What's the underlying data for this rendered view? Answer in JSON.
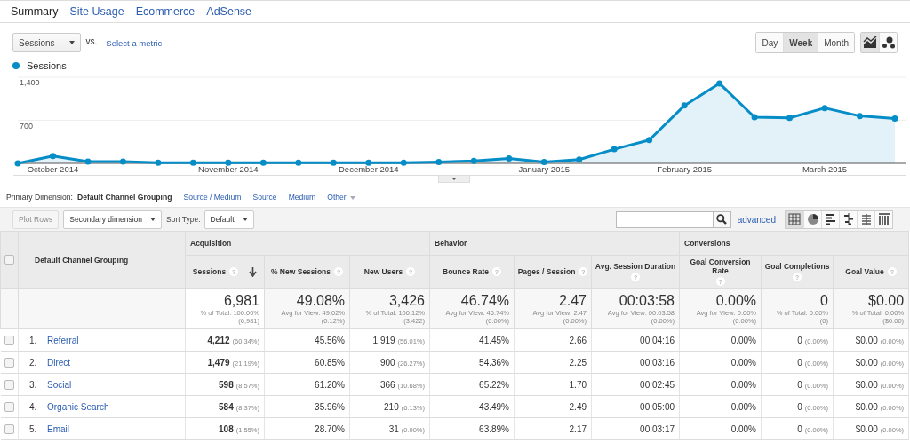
{
  "tabs": [
    {
      "label": "Summary",
      "selected": true
    },
    {
      "label": "Site Usage",
      "selected": false
    },
    {
      "label": "Ecommerce",
      "selected": false
    },
    {
      "label": "AdSense",
      "selected": false
    }
  ],
  "metric_selector": {
    "value": "Sessions",
    "vs_label": "vs.",
    "compare_link": "Select a metric"
  },
  "granularity": [
    {
      "label": "Day",
      "selected": false
    },
    {
      "label": "Week",
      "selected": true
    },
    {
      "label": "Month",
      "selected": false
    }
  ],
  "chart_type_buttons": [
    {
      "kind": "line",
      "selected": true
    },
    {
      "kind": "motion",
      "selected": false
    }
  ],
  "chart_data": {
    "type": "area",
    "categories": [
      null,
      "October 2014",
      null,
      null,
      null,
      null,
      "November 2014",
      null,
      null,
      null,
      "December 2014",
      null,
      null,
      null,
      null,
      "January 2015",
      null,
      null,
      null,
      "February 2015",
      null,
      null,
      null,
      "March 2015",
      null,
      null
    ],
    "series": [
      {
        "name": "Sessions",
        "color": "#058dc7",
        "values": [
          0,
          120,
          30,
          30,
          10,
          10,
          10,
          10,
          10,
          10,
          10,
          10,
          20,
          40,
          80,
          20,
          60,
          230,
          380,
          940,
          1300,
          750,
          740,
          900,
          770,
          730
        ]
      }
    ],
    "ylim": [
      0,
      1400
    ],
    "yticks": [
      {
        "value": 700,
        "label": "700"
      },
      {
        "value": 1400,
        "label": "1,400"
      }
    ]
  },
  "primary_dimension": {
    "label": "Primary Dimension:",
    "options": [
      {
        "label": "Default Channel Grouping",
        "selected": true
      },
      {
        "label": "Source / Medium",
        "selected": false
      },
      {
        "label": "Source",
        "selected": false
      },
      {
        "label": "Medium",
        "selected": false
      }
    ],
    "more": "Other"
  },
  "toolbar": {
    "plot_rows": {
      "label": "Plot Rows",
      "disabled": true
    },
    "secondary_dimension": "Secondary dimension",
    "sort_label": "Sort Type:",
    "sort_value": "Default",
    "advanced_link": "advanced",
    "views": [
      {
        "kind": "table",
        "selected": true
      },
      {
        "kind": "pie",
        "selected": false
      },
      {
        "kind": "bar",
        "selected": false
      },
      {
        "kind": "comparison",
        "selected": false
      },
      {
        "kind": "pivot",
        "selected": false
      },
      {
        "kind": "cloud",
        "selected": false
      }
    ]
  },
  "table": {
    "select_all_checked": false,
    "dimension_header": "Default Channel Grouping",
    "groups": [
      {
        "label": "Acquisition",
        "columns": [
          {
            "label": "Sessions",
            "help": "?",
            "sorted": true
          },
          {
            "label": "% New Sessions",
            "help": "?",
            "sorted": false
          },
          {
            "label": "New Users",
            "help": "?",
            "sorted": false
          }
        ]
      },
      {
        "label": "Behavior",
        "columns": [
          {
            "label": "Bounce Rate",
            "help": "?",
            "sorted": false
          },
          {
            "label": "Pages / Session",
            "help": "?",
            "sorted": false
          },
          {
            "label": "Avg. Session Duration",
            "help": "?",
            "sorted": false
          }
        ]
      },
      {
        "label": "Conversions",
        "columns": [
          {
            "label": "Goal Conversion Rate",
            "help": "?",
            "sorted": false
          },
          {
            "label": "Goal Completions",
            "help": "?",
            "sorted": false
          },
          {
            "label": "Goal Value",
            "help": "?",
            "sorted": false
          }
        ]
      }
    ],
    "totals": [
      {
        "value": "6,981",
        "note": "% of Total: 100.00%",
        "detail": "(6,981)"
      },
      {
        "value": "49.08%",
        "note": "Avg for View: 49.02%",
        "detail": "(0.12%)"
      },
      {
        "value": "3,426",
        "note": "% of Total: 100.12%",
        "detail": "(3,422)"
      },
      {
        "value": "46.74%",
        "note": "Avg for View: 46.74%",
        "detail": "(0.00%)"
      },
      {
        "value": "2.47",
        "note": "Avg for View: 2.47",
        "detail": "(0.00%)"
      },
      {
        "value": "00:03:58",
        "note": "Avg for View: 00:03:58",
        "detail": "(0.00%)"
      },
      {
        "value": "0.00%",
        "note": "Avg for View: 0.00%",
        "detail": "(0.00%)"
      },
      {
        "value": "0",
        "note": "% of Total: 0.00%",
        "detail": "(0)"
      },
      {
        "value": "$0.00",
        "note": "% of Total: 0.00%",
        "detail": "($0.00)"
      }
    ],
    "rows": [
      {
        "checked": false,
        "index": "1.",
        "name": "Referral",
        "cells": [
          {
            "value": "4,212",
            "share": "(60.34%)"
          },
          {
            "value": "45.56%"
          },
          {
            "value": "1,919",
            "share": "(56.01%)"
          },
          {
            "value": "41.45%"
          },
          {
            "value": "2.66"
          },
          {
            "value": "00:04:16"
          },
          {
            "value": "0.00%"
          },
          {
            "value": "0",
            "share": "(0.00%)"
          },
          {
            "value": "$0.00",
            "share": "(0.00%)"
          }
        ]
      },
      {
        "checked": false,
        "index": "2.",
        "name": "Direct",
        "cells": [
          {
            "value": "1,479",
            "share": "(21.19%)"
          },
          {
            "value": "60.85%"
          },
          {
            "value": "900",
            "share": "(26.27%)"
          },
          {
            "value": "54.36%"
          },
          {
            "value": "2.25"
          },
          {
            "value": "00:03:16"
          },
          {
            "value": "0.00%"
          },
          {
            "value": "0",
            "share": "(0.00%)"
          },
          {
            "value": "$0.00",
            "share": "(0.00%)"
          }
        ]
      },
      {
        "checked": false,
        "index": "3.",
        "name": "Social",
        "cells": [
          {
            "value": "598",
            "share": "(8.57%)"
          },
          {
            "value": "61.20%"
          },
          {
            "value": "366",
            "share": "(10.68%)"
          },
          {
            "value": "65.22%"
          },
          {
            "value": "1.70"
          },
          {
            "value": "00:02:45"
          },
          {
            "value": "0.00%"
          },
          {
            "value": "0",
            "share": "(0.00%)"
          },
          {
            "value": "$0.00",
            "share": "(0.00%)"
          }
        ]
      },
      {
        "checked": false,
        "index": "4.",
        "name": "Organic Search",
        "cells": [
          {
            "value": "584",
            "share": "(8.37%)"
          },
          {
            "value": "35.96%"
          },
          {
            "value": "210",
            "share": "(6.13%)"
          },
          {
            "value": "43.49%"
          },
          {
            "value": "2.49"
          },
          {
            "value": "00:05:00"
          },
          {
            "value": "0.00%"
          },
          {
            "value": "0",
            "share": "(0.00%)"
          },
          {
            "value": "$0.00",
            "share": "(0.00%)"
          }
        ]
      },
      {
        "checked": false,
        "index": "5.",
        "name": "Email",
        "cells": [
          {
            "value": "108",
            "share": "(1.55%)"
          },
          {
            "value": "28.70%"
          },
          {
            "value": "31",
            "share": "(0.90%)"
          },
          {
            "value": "63.89%"
          },
          {
            "value": "2.17"
          },
          {
            "value": "00:03:17"
          },
          {
            "value": "0.00%"
          },
          {
            "value": "0",
            "share": "(0.00%)"
          },
          {
            "value": "$0.00",
            "share": "(0.00%)"
          }
        ]
      }
    ]
  }
}
